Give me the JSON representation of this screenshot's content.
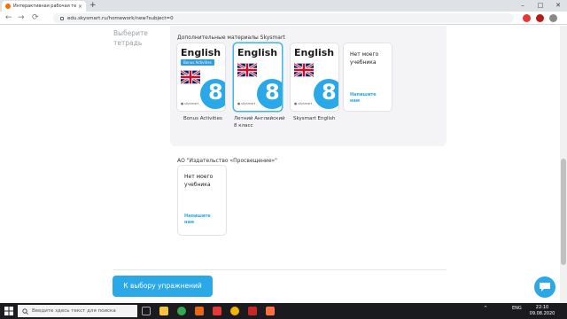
{
  "browser": {
    "tab_title": "Интерактивная рабочая тетрадь",
    "close": "×",
    "new_tab": "+",
    "url": "edu.skysmart.ru/homework/new?subject=0",
    "win_min": "–",
    "win_max": "□",
    "win_close": "✕",
    "back": "←",
    "forward": "→",
    "reload": "⟳"
  },
  "sidebar": {
    "label": "Выберите тетрадь"
  },
  "additional": {
    "title": "Дополнительные материалы Skysmart",
    "books": [
      {
        "cover_title": "English",
        "cover_badge": "Bonus Activities",
        "cover_number": "8",
        "publisher": "● skysmart",
        "label": "Bonus Activities"
      },
      {
        "cover_title": "English",
        "cover_number": "8",
        "publisher": "● skysmart",
        "label": "Летний Английский 8 класс"
      },
      {
        "cover_title": "English",
        "cover_number": "8",
        "publisher": "● skysmart",
        "label": "Skysmart English"
      }
    ],
    "no_book": {
      "title": "Нет моего учебника",
      "link": "Напишите нам"
    }
  },
  "publisher_section": {
    "title": "АО \"Издательство «Просвещение»\"",
    "no_book": {
      "title": "Нет моего учебника",
      "link": "Напишите нам"
    }
  },
  "footer": {
    "cta": "К выбору упражнений"
  },
  "taskbar": {
    "search_placeholder": "Введите здесь текст для поиска",
    "lang": "ENG",
    "time": "22:10",
    "date": "09.08.2020",
    "tray_chevron": "^"
  },
  "colors": {
    "accent": "#2aa8e8",
    "panel": "#f4f4f6",
    "taskbar": "#1b1b1f"
  }
}
